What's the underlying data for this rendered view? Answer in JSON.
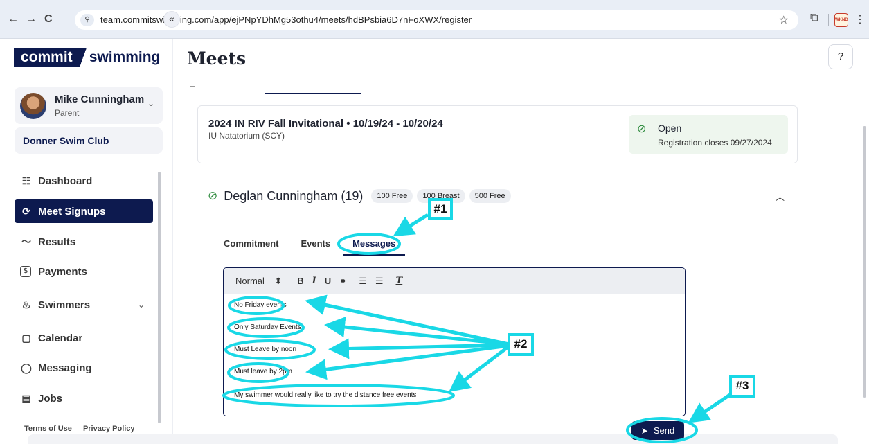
{
  "browser": {
    "back": "←",
    "forward": "→",
    "reload": "C",
    "site_icon": "⚲",
    "url": "team.commitswimming.com/app/ejPNpYDhMg53othu4/meets/hdBPsbia6D7nFoXWX/register",
    "bookmark": "☆",
    "extensions": "⧉",
    "menu": "⋮",
    "profile_text": "WKND"
  },
  "brand": {
    "box_text": "commit",
    "word": "swimming",
    "color": "#0d1a4f"
  },
  "sidebar": {
    "collapse": "«",
    "user": {
      "name": "Mike Cunningham",
      "role": "Parent"
    },
    "club": "Donner Swim Club",
    "items": [
      {
        "label": "Dashboard",
        "icon": "☷"
      },
      {
        "label": "Meet Signups",
        "icon": "⟳"
      },
      {
        "label": "Results",
        "icon": "〜"
      },
      {
        "label": "Payments",
        "icon": "$"
      },
      {
        "label": "Swimmers",
        "icon": "♨"
      },
      {
        "label": "Calendar",
        "icon": "▢"
      },
      {
        "label": "Messaging",
        "icon": "◯"
      },
      {
        "label": "Jobs",
        "icon": "▤"
      }
    ],
    "footer": {
      "terms": "Terms of Use",
      "privacy": "Privacy Policy"
    }
  },
  "main": {
    "title": "Meets",
    "help": "?",
    "meet": {
      "title": "2024 IN RIV Fall Invitational • 10/19/24 - 10/20/24",
      "location": "IU Natatorium (SCY)",
      "status": "Open",
      "closes": "Registration closes 09/27/2024"
    },
    "swimmer": {
      "name": "Deglan Cunningham (19)",
      "events": [
        "100 Free",
        "100 Breast",
        "500 Free"
      ]
    },
    "tabs": [
      "Commitment",
      "Events",
      "Messages"
    ],
    "toolbar": {
      "format": "Normal",
      "format_arrow": "⬍",
      "bold": "B",
      "italic": "I",
      "underline": "U",
      "link": "🔗",
      "ordered": "☰",
      "bullet": "☰",
      "clear": "T"
    },
    "message_lines": [
      "No Friday events",
      "Only Saturday Events",
      "Must Leave by noon",
      "Must leave by 2pm",
      "My swimmer would really like to try the distance free events"
    ],
    "send": "Send",
    "send_icon": "➤"
  },
  "annotations": [
    "#1",
    "#2",
    "#3"
  ],
  "colors": {
    "accent": "#0d1a4f",
    "annotation": "#19d8e6",
    "open_green": "#2e8b3e"
  }
}
